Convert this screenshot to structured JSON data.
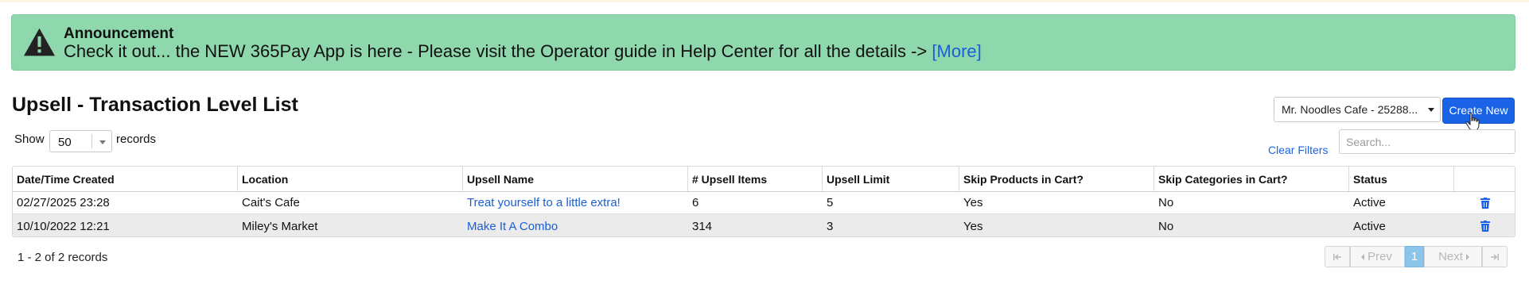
{
  "announcement": {
    "title": "Announcement",
    "message": "Check it out... the NEW 365Pay App is here - Please visit the Operator guide in Help Center for all the details ->",
    "link_text": "[More]",
    "icon": "warning-icon"
  },
  "page": {
    "title": "Upsell - Transaction Level List"
  },
  "toolbar": {
    "location_selected": "Mr. Noodles Cafe - 25288...",
    "create_label": "Create New",
    "show_label": "Show",
    "page_length": "50",
    "records_label": "records",
    "clear_filters": "Clear Filters",
    "search_placeholder": "Search..."
  },
  "table": {
    "headers": [
      "Date/Time Created",
      "Location",
      "Upsell Name",
      "# Upsell Items",
      "Upsell Limit",
      "Skip Products in Cart?",
      "Skip Categories in Cart?",
      "Status"
    ],
    "rows": [
      [
        "02/27/2025 23:28",
        "Cait's Cafe",
        "Treat yourself to a little extra!",
        "6",
        "5",
        "Yes",
        "No",
        "Active"
      ],
      [
        "10/10/2022 12:21",
        "Miley's Market",
        "Make It A Combo",
        "314",
        "3",
        "Yes",
        "No",
        "Active"
      ]
    ]
  },
  "footer": {
    "info": "1 - 2 of 2 records",
    "prev_label": "Prev",
    "current_page": "1",
    "next_label": "Next"
  },
  "colors": {
    "announcement_bg": "#8fd8ad",
    "accent": "#1a63e6",
    "link": "#1a5fd6",
    "active_page": "#8cc5ea",
    "delete_icon": "#1a63e6"
  }
}
